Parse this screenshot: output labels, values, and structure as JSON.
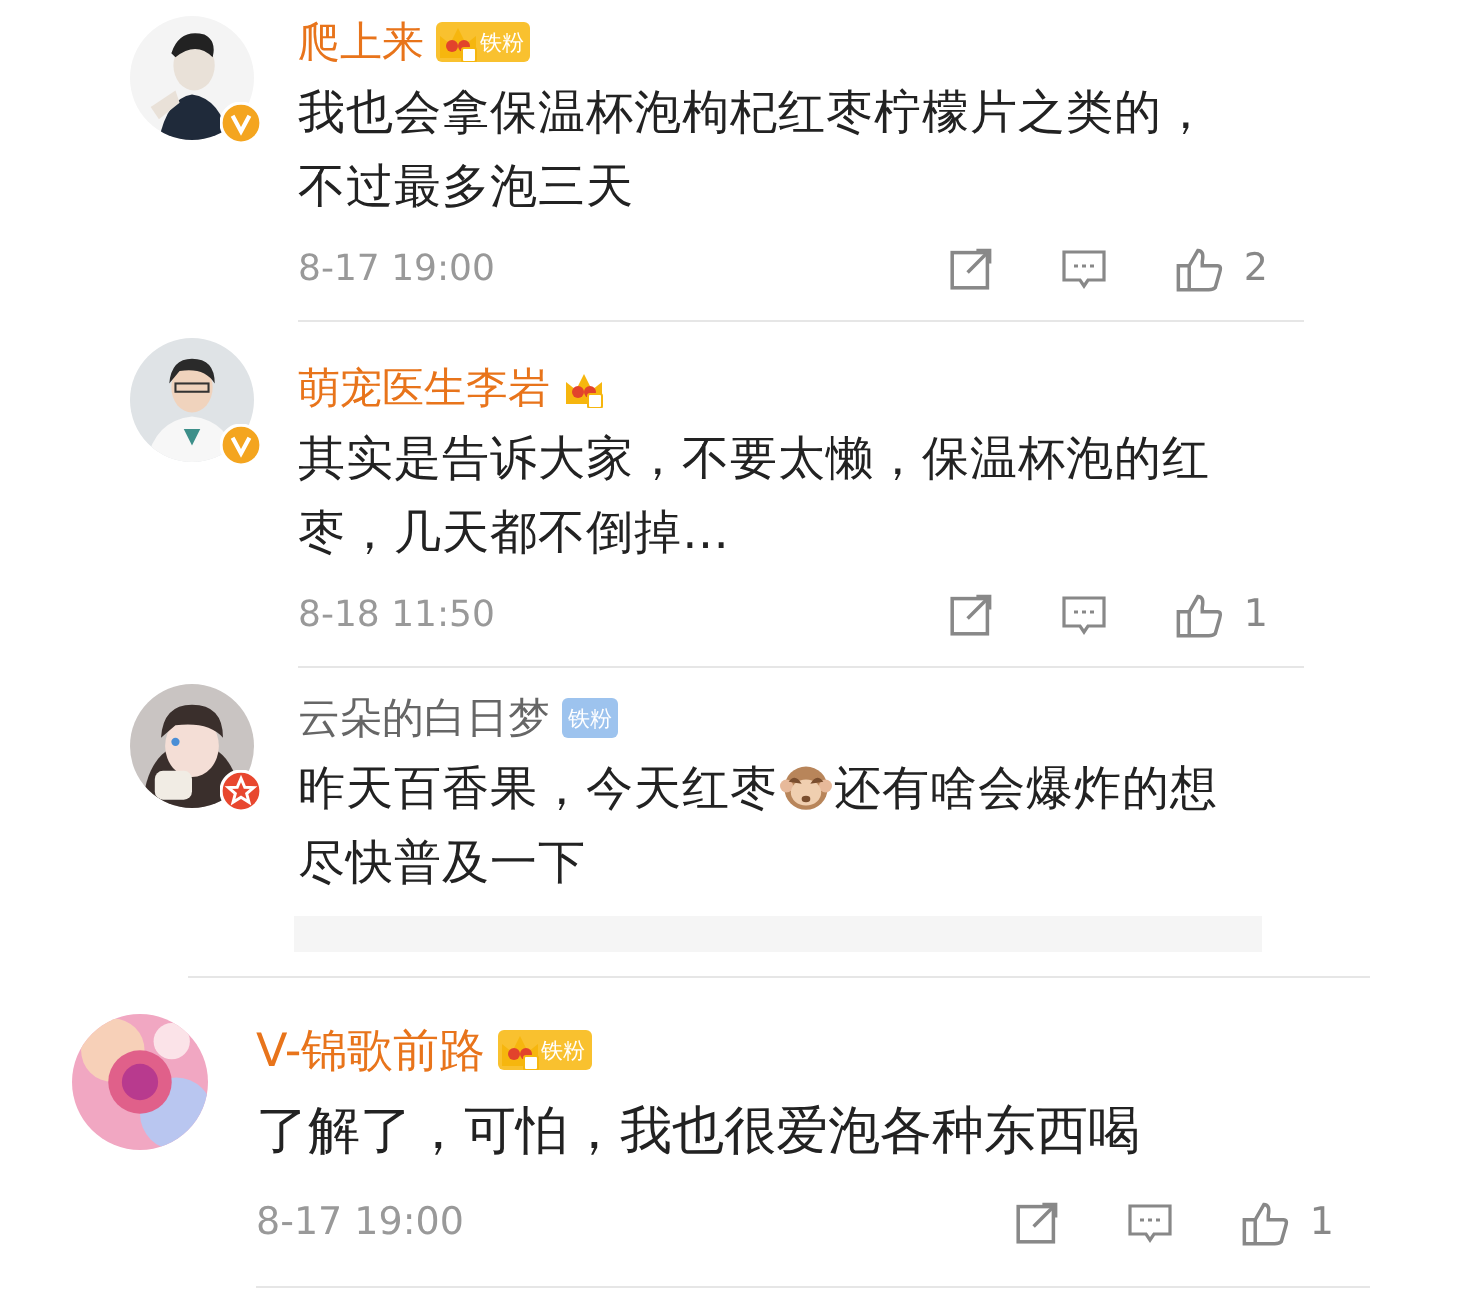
{
  "comments": [
    {
      "kind": "inner",
      "name": "爬上来",
      "vip": true,
      "avatar_badge": {
        "kind": "verified"
      },
      "fan_badge": {
        "crown": true,
        "label": "铁粉"
      },
      "text": [
        {
          "kind": "text",
          "value": "我也会拿保温杯泡枸杞红枣柠檬片之类的，不过最多泡三天"
        }
      ],
      "time": "8-17 19:00",
      "likes": "2"
    },
    {
      "kind": "inner",
      "name": "萌宠医生李岩",
      "vip": true,
      "avatar_badge": {
        "kind": "verified"
      },
      "fan_badge": {
        "crown": true
      },
      "text": [
        {
          "kind": "text",
          "value": "其实是告诉大家，不要太懒，保温杯泡的红枣，几天都不倒掉…"
        }
      ],
      "time": "8-18 11:50",
      "likes": "1"
    },
    {
      "kind": "inner",
      "name": "云朵的白日梦",
      "vip": false,
      "avatar_badge": {
        "kind": "star"
      },
      "fan_badge": {
        "crown": false,
        "label": "铁粉"
      },
      "text": [
        {
          "kind": "text",
          "value": "昨天百香果，今天红枣"
        },
        {
          "kind": "emoji"
        },
        {
          "kind": "text",
          "value": "还有啥会爆炸的想"
        },
        {
          "kind": "break"
        },
        {
          "kind": "text",
          "value": "尽快普及一下"
        }
      ],
      "has_replies": true
    },
    {
      "kind": "outer",
      "name": "V-锦歌前路",
      "vip": true,
      "fan_badge": {
        "crown": true,
        "label": "铁粉"
      },
      "text": [
        {
          "kind": "text",
          "value": "了解了，可怕，我也很爱泡各种东西喝"
        }
      ],
      "time": "8-17 19:00",
      "likes": "1"
    }
  ]
}
